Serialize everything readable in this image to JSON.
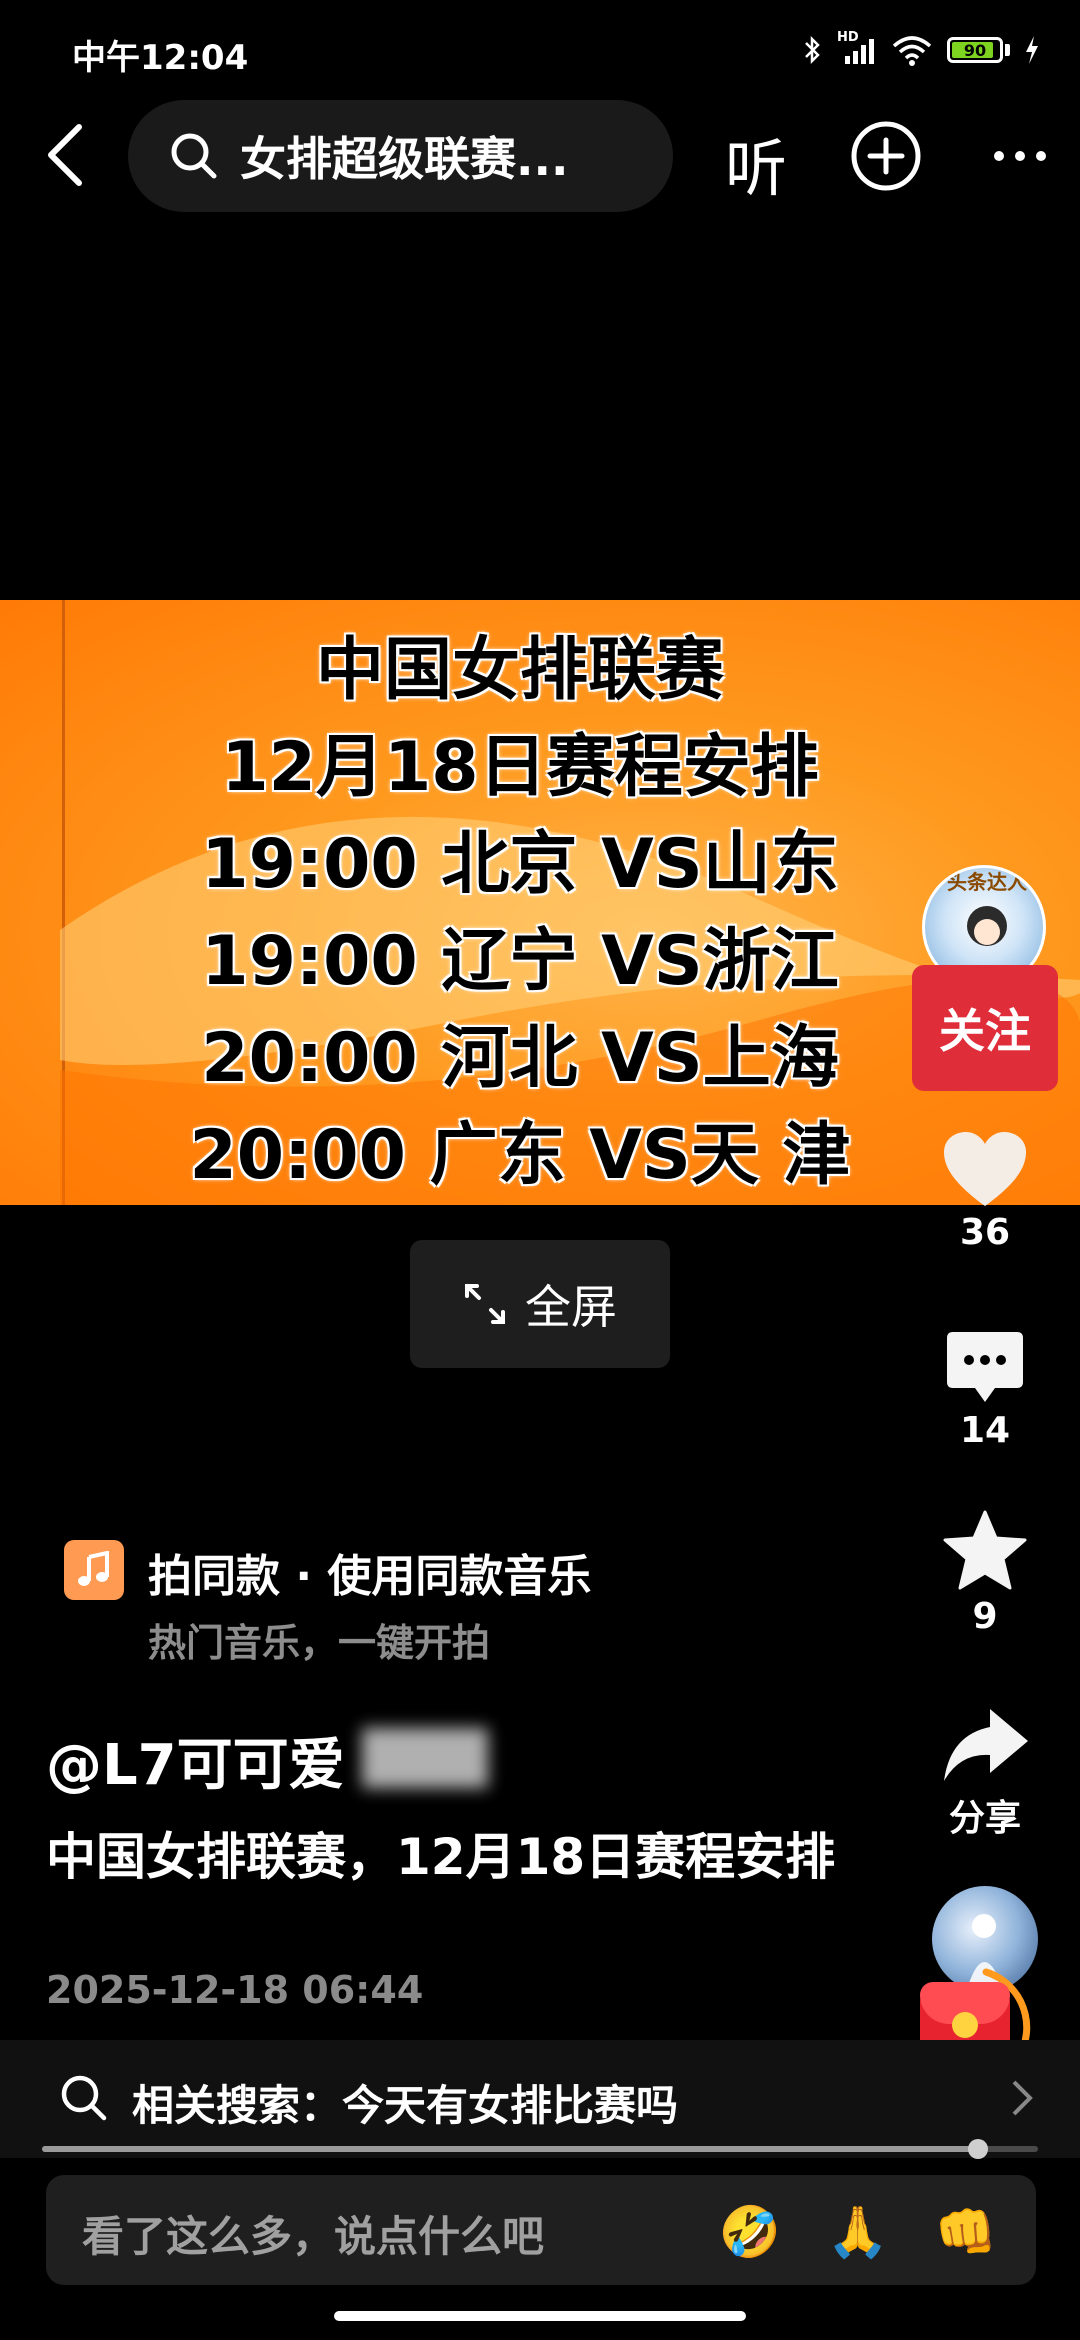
{
  "status": {
    "time": "中午12:04",
    "network_badge": "HD",
    "battery": "90"
  },
  "nav": {
    "search_query": "女排超级联赛...",
    "listen_label": "听",
    "icons": [
      "back-arrow-icon",
      "search-icon",
      "plus-circle-icon",
      "more-icon"
    ]
  },
  "video": {
    "banner_lines": [
      "中国女排联赛",
      "12月18日赛程安排",
      "19:00 北京 VS山东",
      "19:00 辽宁 VS浙江",
      "20:00 河北 VS上海",
      "20:00 广东 VS天 津"
    ],
    "fullscreen_label": "全屏"
  },
  "rail": {
    "avatar_badge": "头条达人",
    "follow_label": "关注",
    "like_count": "36",
    "comment_count": "14",
    "favorite_count": "9",
    "share_label": "分享"
  },
  "music": {
    "title": "拍同款 · 使用同款音乐",
    "subtitle": "热门音乐，一键开拍"
  },
  "post": {
    "author": "@L7可可爱",
    "description": "中国女排联赛，12月18日赛程安排",
    "time": "2025-12-18 06:44"
  },
  "related": {
    "label": "相关搜索：今天有女排比赛吗"
  },
  "progress": {
    "fraction": 0.94
  },
  "comment": {
    "placeholder": "看了这么多，说点什么吧",
    "emojis": [
      "🤣",
      "🙏",
      "👊"
    ]
  },
  "colors": {
    "follow": "#e02d3a",
    "banner": "#ff8a0e",
    "music_icon": "#ff9a52"
  }
}
